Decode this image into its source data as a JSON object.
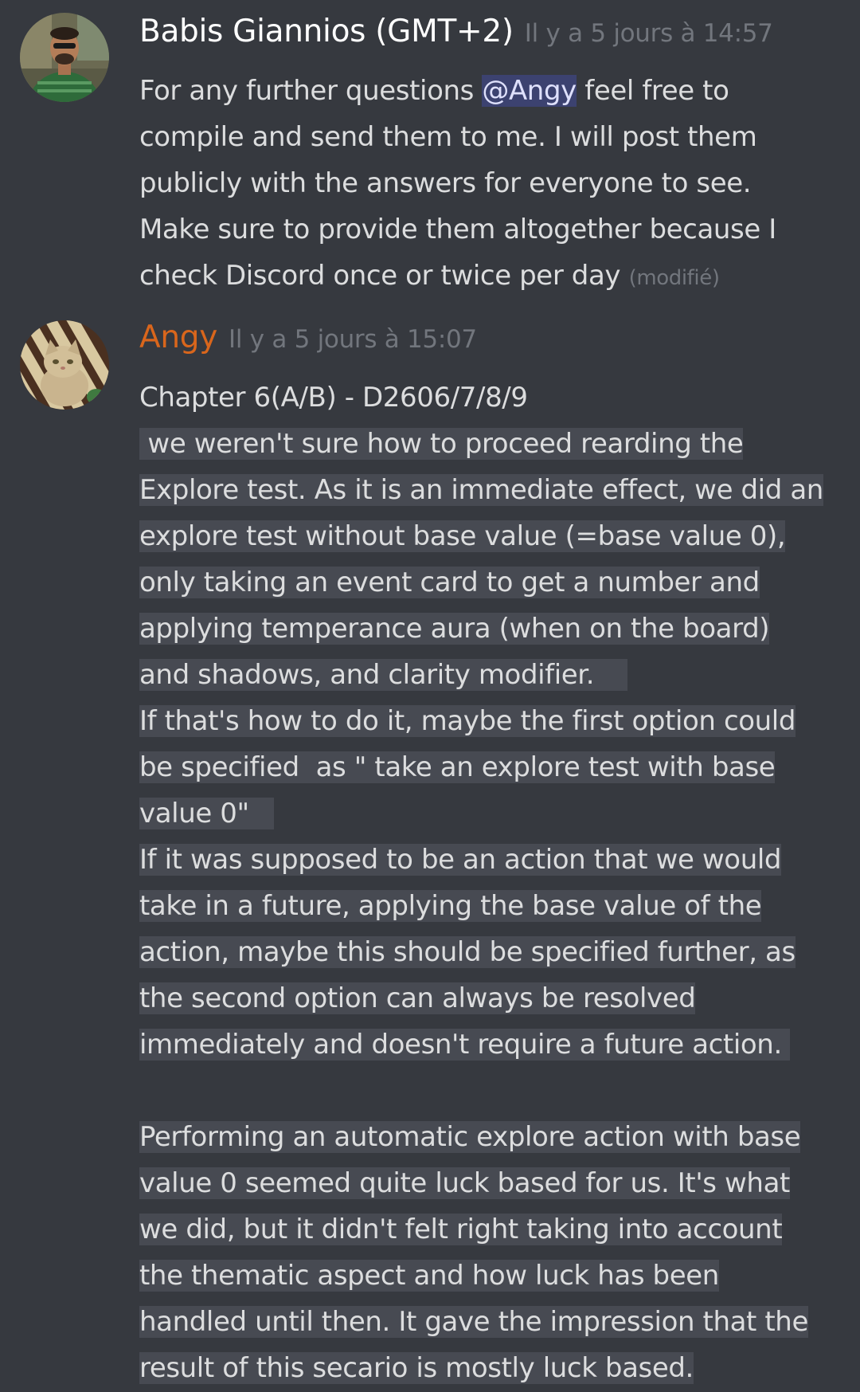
{
  "messages": [
    {
      "author": "Babis Giannios (GMT+2)",
      "author_color": "#ffffff",
      "timestamp": "Il y a 5 jours à 14:57",
      "avatar_icon": "user-photo-man-green-shirt",
      "lines": {
        "l1_pre": "For any further questions ",
        "l1_mention": "@Angy",
        "l1_post": " feel free to",
        "l2": "compile and send them to me. I will post them",
        "l3": "publicly with the answers for everyone to see.",
        "l4": "Make sure to provide them altogether because I",
        "l5": "check Discord once or twice per day"
      },
      "edited_label": "(modifié)"
    },
    {
      "author": "Angy",
      "author_color": "#d9661c",
      "timestamp": "Il y a 5 jours à 15:07",
      "avatar_icon": "user-photo-cat",
      "lines": [
        "Chapter 6(A/B) - D2606/7/8/9",
        " we weren't sure how to proceed rearding the",
        "Explore test. As it is an immediate effect, we did an",
        "explore test without base value (=base value 0),",
        "only taking an event card to get a number and",
        "applying temperance aura (when on the board)",
        "and shadows, and clarity modifier.",
        "If that's how to do it, maybe the first option could",
        "be specified  as \" take an explore test with base",
        "value 0\"",
        "If it was supposed to be an action that we would",
        "take in a future, applying the base value of the",
        "action, maybe this should be specified further, as",
        "the second option can always be resolved",
        "immediately and doesn't require a future action.",
        "",
        "Performing an automatic explore action with base",
        "value 0 seemed quite luck based for us. It's what",
        "we did, but it didn't felt right taking into account",
        "the thematic aspect and how luck has been",
        "handled until then. It gave the impression that the",
        "result of this secario is mostly luck based."
      ]
    }
  ],
  "colors": {
    "background": "#36393f",
    "text": "#dcddde",
    "timestamp": "#72767d",
    "selection_highlight": "#474a52",
    "mention_bg": "#3c4270"
  }
}
